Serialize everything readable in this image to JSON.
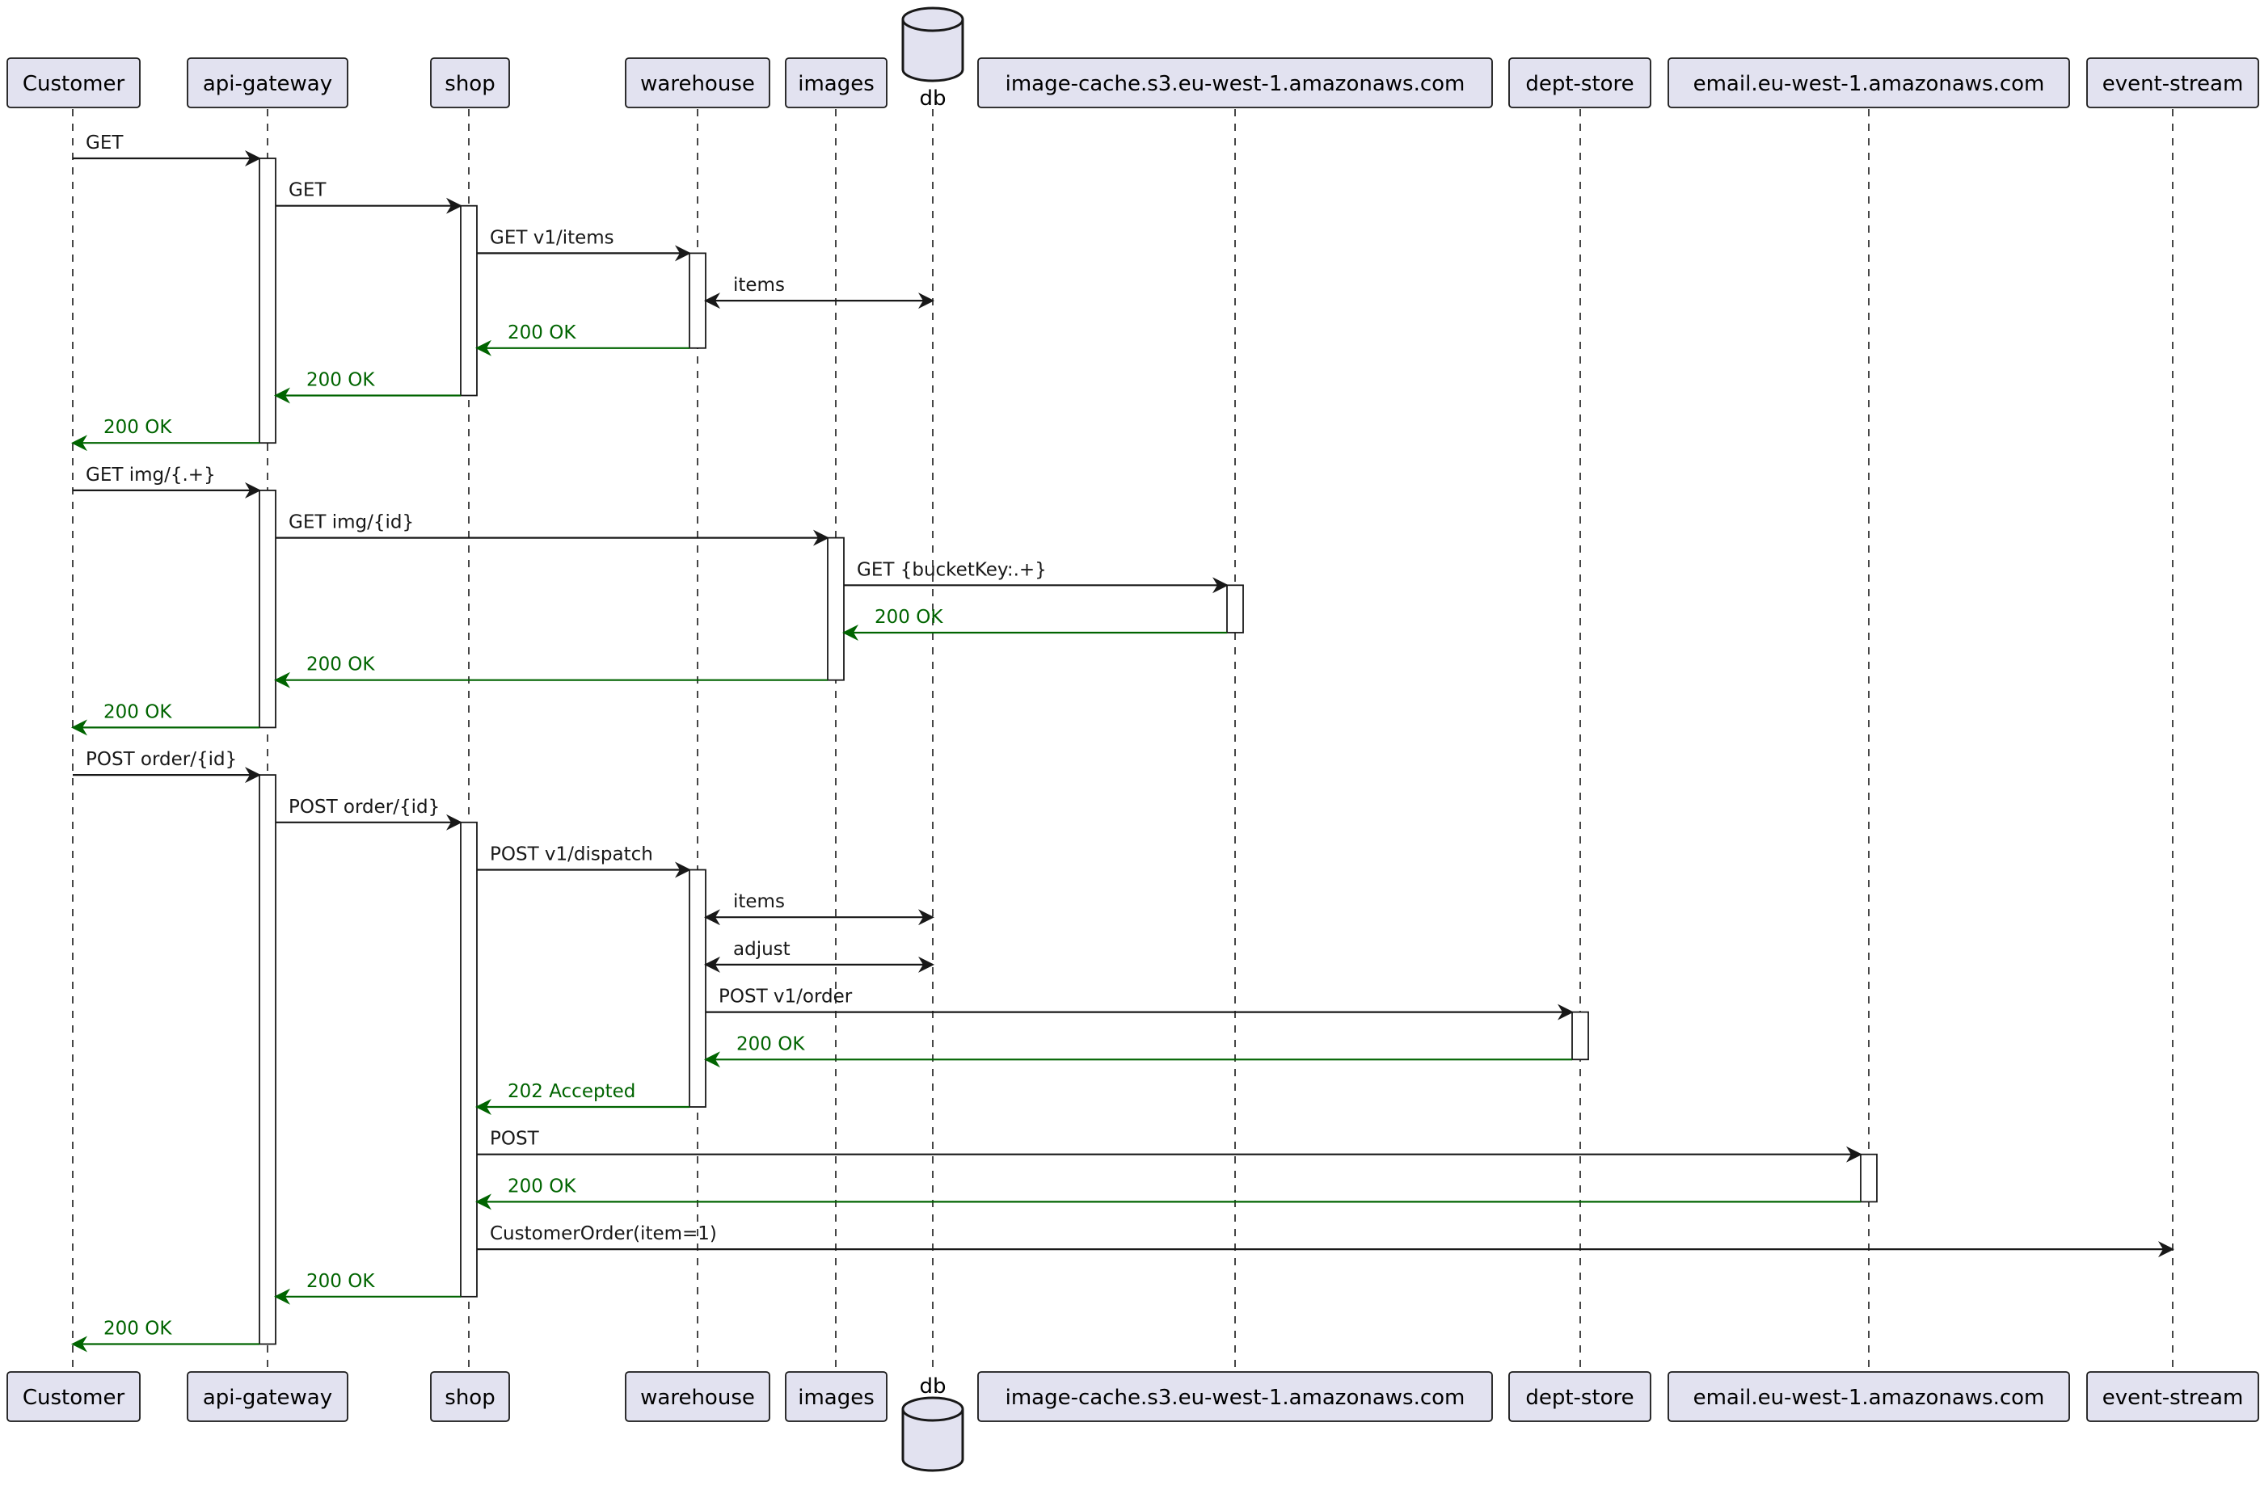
{
  "diagram": {
    "type": "sequence",
    "colors": {
      "participant_fill": "#E2E2F0",
      "line": "#181818",
      "reply": "#006400",
      "text": "#000000"
    },
    "participants": [
      {
        "id": "customer",
        "label": "Customer",
        "kind": "participant"
      },
      {
        "id": "api-gateway",
        "label": "api-gateway",
        "kind": "participant"
      },
      {
        "id": "shop",
        "label": "shop",
        "kind": "participant"
      },
      {
        "id": "warehouse",
        "label": "warehouse",
        "kind": "participant"
      },
      {
        "id": "images",
        "label": "images",
        "kind": "participant"
      },
      {
        "id": "db",
        "label": "db",
        "kind": "database"
      },
      {
        "id": "image-cache",
        "label": "image-cache.s3.eu-west-1.amazonaws.com",
        "kind": "participant"
      },
      {
        "id": "dept-store",
        "label": "dept-store",
        "kind": "participant"
      },
      {
        "id": "email",
        "label": "email.eu-west-1.amazonaws.com",
        "kind": "participant"
      },
      {
        "id": "event-stream",
        "label": "event-stream",
        "kind": "participant"
      }
    ],
    "messages": [
      {
        "from": "customer",
        "to": "api-gateway",
        "label": "GET",
        "style": "request"
      },
      {
        "from": "api-gateway",
        "to": "shop",
        "label": "GET",
        "style": "request"
      },
      {
        "from": "shop",
        "to": "warehouse",
        "label": "GET v1/items",
        "style": "request"
      },
      {
        "from": "warehouse",
        "to": "db",
        "label": "items",
        "style": "bidirectional"
      },
      {
        "from": "warehouse",
        "to": "shop",
        "label": "200 OK",
        "style": "reply"
      },
      {
        "from": "shop",
        "to": "api-gateway",
        "label": "200 OK",
        "style": "reply"
      },
      {
        "from": "api-gateway",
        "to": "customer",
        "label": "200 OK",
        "style": "reply"
      },
      {
        "from": "customer",
        "to": "api-gateway",
        "label": "GET img/{.+}",
        "style": "request"
      },
      {
        "from": "api-gateway",
        "to": "images",
        "label": "GET img/{id}",
        "style": "request"
      },
      {
        "from": "images",
        "to": "image-cache",
        "label": "GET {bucketKey:.+}",
        "style": "request"
      },
      {
        "from": "image-cache",
        "to": "images",
        "label": "200 OK",
        "style": "reply"
      },
      {
        "from": "images",
        "to": "api-gateway",
        "label": "200 OK",
        "style": "reply"
      },
      {
        "from": "api-gateway",
        "to": "customer",
        "label": "200 OK",
        "style": "reply"
      },
      {
        "from": "customer",
        "to": "api-gateway",
        "label": "POST order/{id}",
        "style": "request"
      },
      {
        "from": "api-gateway",
        "to": "shop",
        "label": "POST order/{id}",
        "style": "request"
      },
      {
        "from": "shop",
        "to": "warehouse",
        "label": "POST v1/dispatch",
        "style": "request"
      },
      {
        "from": "warehouse",
        "to": "db",
        "label": "items",
        "style": "bidirectional"
      },
      {
        "from": "warehouse",
        "to": "db",
        "label": "adjust",
        "style": "bidirectional"
      },
      {
        "from": "warehouse",
        "to": "dept-store",
        "label": "POST v1/order",
        "style": "request"
      },
      {
        "from": "dept-store",
        "to": "warehouse",
        "label": "200 OK",
        "style": "reply"
      },
      {
        "from": "warehouse",
        "to": "shop",
        "label": "202 Accepted",
        "style": "reply"
      },
      {
        "from": "shop",
        "to": "email",
        "label": "POST",
        "style": "request"
      },
      {
        "from": "email",
        "to": "shop",
        "label": "200 OK",
        "style": "reply"
      },
      {
        "from": "shop",
        "to": "event-stream",
        "label": "CustomerOrder(item=1)",
        "style": "request"
      },
      {
        "from": "shop",
        "to": "api-gateway",
        "label": "200 OK",
        "style": "reply"
      },
      {
        "from": "api-gateway",
        "to": "customer",
        "label": "200 OK",
        "style": "reply"
      }
    ],
    "activations": [
      {
        "participant": "api-gateway",
        "from_msg": 0,
        "to_msg": 6
      },
      {
        "participant": "shop",
        "from_msg": 1,
        "to_msg": 5
      },
      {
        "participant": "warehouse",
        "from_msg": 2,
        "to_msg": 4
      },
      {
        "participant": "api-gateway",
        "from_msg": 7,
        "to_msg": 12
      },
      {
        "participant": "images",
        "from_msg": 8,
        "to_msg": 11
      },
      {
        "participant": "image-cache",
        "from_msg": 9,
        "to_msg": 10
      },
      {
        "participant": "api-gateway",
        "from_msg": 13,
        "to_msg": 25
      },
      {
        "participant": "shop",
        "from_msg": 14,
        "to_msg": 24
      },
      {
        "participant": "warehouse",
        "from_msg": 15,
        "to_msg": 20
      },
      {
        "participant": "dept-store",
        "from_msg": 18,
        "to_msg": 19
      },
      {
        "participant": "email",
        "from_msg": 21,
        "to_msg": 22
      }
    ]
  }
}
